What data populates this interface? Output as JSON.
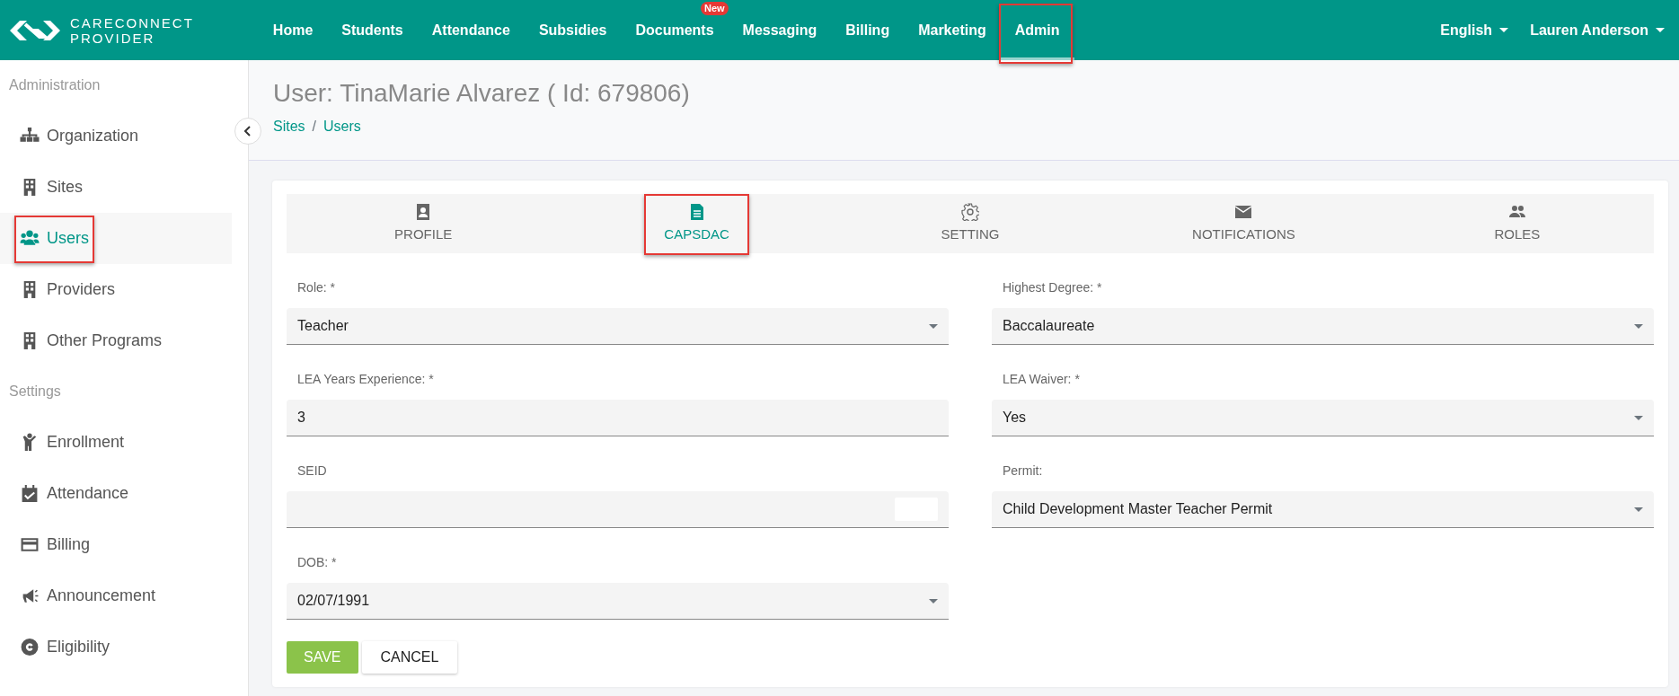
{
  "brand": {
    "line1": "CARECONNECT",
    "line2": "PROVIDER"
  },
  "nav": [
    {
      "label": "Home",
      "selected": false,
      "highlighted": false
    },
    {
      "label": "Students",
      "selected": false,
      "highlighted": false
    },
    {
      "label": "Attendance",
      "selected": false,
      "highlighted": false
    },
    {
      "label": "Subsidies",
      "selected": false,
      "highlighted": false
    },
    {
      "label": "Documents",
      "selected": false,
      "highlighted": false,
      "badge": "New"
    },
    {
      "label": "Messaging",
      "selected": false,
      "highlighted": false
    },
    {
      "label": "Billing",
      "selected": false,
      "highlighted": false
    },
    {
      "label": "Marketing",
      "selected": false,
      "highlighted": false
    },
    {
      "label": "Admin",
      "selected": true,
      "highlighted": true
    }
  ],
  "nav_right": [
    {
      "label": "English"
    },
    {
      "label": "Lauren Anderson"
    }
  ],
  "sidebar": [
    {
      "heading": "Administration",
      "items": [
        {
          "label": "Organization",
          "selected": false,
          "highlighted": false
        },
        {
          "label": "Sites",
          "selected": false,
          "highlighted": false
        },
        {
          "label": "Users",
          "selected": true,
          "highlighted": true
        },
        {
          "label": "Providers",
          "selected": false,
          "highlighted": false
        },
        {
          "label": "Other Programs",
          "selected": false,
          "highlighted": false
        }
      ]
    },
    {
      "heading": "Settings",
      "items": [
        {
          "label": "Enrollment",
          "selected": false,
          "highlighted": false
        },
        {
          "label": "Attendance",
          "selected": false,
          "highlighted": false
        },
        {
          "label": "Billing",
          "selected": false,
          "highlighted": false
        },
        {
          "label": "Announcement",
          "selected": false,
          "highlighted": false
        },
        {
          "label": "Eligibility",
          "selected": false,
          "highlighted": false
        }
      ]
    }
  ],
  "page": {
    "title": "User: TinaMarie Alvarez ( Id: 679806)",
    "breadcrumb": [
      {
        "label": "Sites"
      },
      {
        "label": "Users"
      }
    ],
    "breadcrumb_separator": "/"
  },
  "tabs": [
    {
      "label": "PROFILE",
      "selected": false,
      "highlighted": false
    },
    {
      "label": "CAPSDAC",
      "selected": true,
      "highlighted": true
    },
    {
      "label": "SETTING",
      "selected": false,
      "highlighted": false
    },
    {
      "label": "NOTIFICATIONS",
      "selected": false,
      "highlighted": false
    },
    {
      "label": "ROLES",
      "selected": false,
      "highlighted": false
    }
  ],
  "form": {
    "left": [
      {
        "label": "Role: *",
        "kind": "select",
        "value": "Teacher"
      },
      {
        "label": "LEA Years Experience: *",
        "kind": "text",
        "value": "3"
      },
      {
        "label": "SEID",
        "kind": "text",
        "redacted": true
      },
      {
        "label": "DOB: *",
        "kind": "select",
        "value": "02/07/1991"
      }
    ],
    "right": [
      {
        "label": "Highest Degree: *",
        "kind": "select",
        "value": "Baccalaureate"
      },
      {
        "label": "LEA Waiver: *",
        "kind": "select",
        "value": "Yes"
      },
      {
        "label": "Permit:",
        "kind": "select",
        "value": "Child Development Master Teacher Permit"
      }
    ]
  },
  "buttons": [
    {
      "label": "SAVE",
      "kind": "primary"
    },
    {
      "label": "CANCEL",
      "kind": "secondary"
    }
  ]
}
